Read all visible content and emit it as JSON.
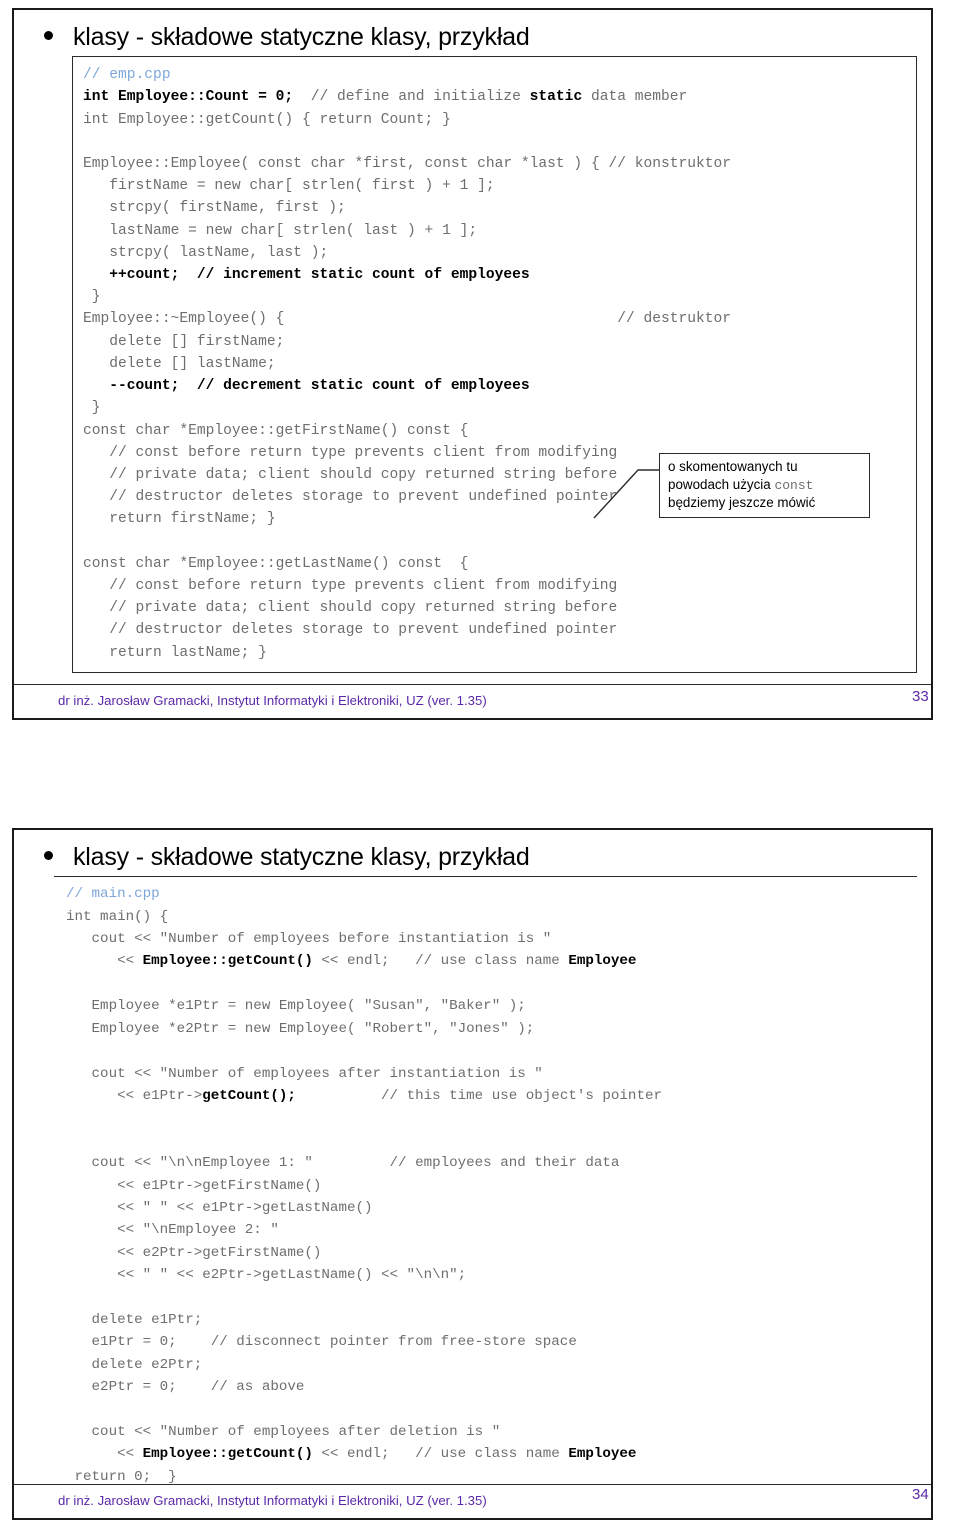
{
  "document": {
    "kind": "lecture-slides",
    "language": "pl"
  },
  "colors": {
    "footer_text": "#5b29a8",
    "code_text": "#6e6e6e",
    "code_bold": "#000000",
    "file_comment": "#7da7d9",
    "border": "#2b2b2b"
  },
  "slides": [
    {
      "number": "33",
      "title": "klasy - składowe statyczne klasy, przykład",
      "file_comment": "// emp.cpp",
      "footer": "dr inż. Jarosław Gramacki, Instytut Informatyki i Elektroniki, UZ (ver. 1.35)",
      "code": "int Employee::Count = 0;  // define and initialize static data member\nint Employee::getCount() { return Count; }\n\nEmployee::Employee( const char *first, const char *last ) { // konstruktor\n   firstName = new char[ strlen( first ) + 1 ];\n   strcpy( firstName, first );\n   lastName = new char[ strlen( last ) + 1 ];\n   strcpy( lastName, last );\n   ++count;  // increment static count of employees\n }\nEmployee::~Employee() {                                      // destruktor\n   delete [] firstName;\n   delete [] lastName;\n   --count;  // decrement static count of employees\n }\nconst char *Employee::getFirstName() const {\n   // const before return type prevents client from modifying\n   // private data; client should copy returned string before\n   // destructor deletes storage to prevent undefined pointer\n   return firstName; }\n\nconst char *Employee::getLastName() const  {\n   // const before return type prevents client from modifying\n   // private data; client should copy returned string before\n   // destructor deletes storage to prevent undefined pointer\n   return lastName; }",
      "callout": {
        "line1": "o skomentowanych tu",
        "line2_prefix": "powodach użycia ",
        "line2_mono": "const",
        "line3": "będziemy jeszcze mówić"
      }
    },
    {
      "number": "34",
      "title": "klasy - składowe statyczne klasy, przykład",
      "file_comment": "// main.cpp",
      "footer": "dr inż. Jarosław Gramacki, Instytut Informatyki i Elektroniki, UZ (ver. 1.35)",
      "code": "int main() {\n   cout << \"Number of employees before instantiation is \"\n      << Employee::getCount() << endl;   // use class name Employee\n\n   Employee *e1Ptr = new Employee( \"Susan\", \"Baker\" );\n   Employee *e2Ptr = new Employee( \"Robert\", \"Jones\" );\n\n   cout << \"Number of employees after instantiation is \"\n      << e1Ptr->getCount();          // this time use object's pointer\n\n\n   cout << \"\\n\\nEmployee 1: \"         // employees and their data\n      << e1Ptr->getFirstName()\n      << \" \" << e1Ptr->getLastName()\n      << \"\\nEmployee 2: \"\n      << e2Ptr->getFirstName()\n      << \" \" << e2Ptr->getLastName() << \"\\n\\n\";\n\n   delete e1Ptr;\n   e1Ptr = 0;    // disconnect pointer from free-store space\n   delete e2Ptr;\n   e2Ptr = 0;    // as above\n\n   cout << \"Number of employees after deletion is \"\n      << Employee::getCount() << endl;   // use class name Employee\n return 0;  }"
    }
  ]
}
